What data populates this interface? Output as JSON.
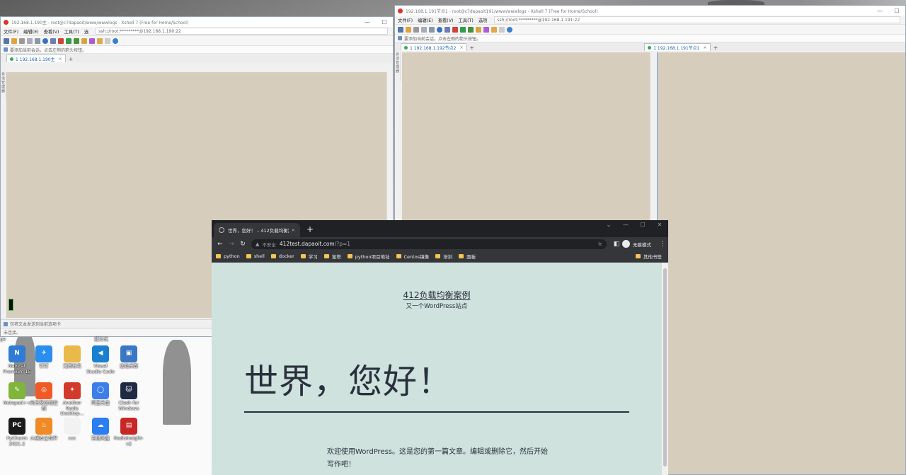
{
  "xshell_left": {
    "title": "192.168.1.190主 - root@c7dapaoit/www/wwwlogs - Xshell 7 (Free for Home/School)",
    "menu": [
      "文件(F)",
      "编辑(E)",
      "查看(V)",
      "工具(T)",
      "选"
    ],
    "address": "ssh://root:*********@192.168.1.190:22",
    "hint": "要添加当前会话，点击左侧的箭头按钮。",
    "tab_label": "1 192.168.1.190主",
    "side_label": "会话管理器",
    "status": "仅将文本发送到当前选项卡",
    "disconnected": "未连接。"
  },
  "xshell_right": {
    "title": "192.168.1.191节点1 - root@c7dapaoit191/www/wwwlogs - Xshell 7 (Free for Home/School)",
    "menu": [
      "文件(F)",
      "编辑(E)",
      "查看(V)",
      "工具(T)",
      "选项"
    ],
    "address": "ssh://root:*********@192.168.1.191:22",
    "hint": "要添加当前会话，点击左侧的箭头按钮。",
    "tab_left": "1 192.168.1.192节点2",
    "tab_right": "1 192.168.1.191节点1",
    "side_label": "会话管理器"
  },
  "desktop": {
    "partial_labels": [
      "ge",
      "捷方式"
    ],
    "icons": [
      {
        "label": "Navicat Premium 15",
        "icon": "navicat-icon",
        "color": "#2f7bd6",
        "glyph": "N"
      },
      {
        "label": "钉钉",
        "icon": "dingtalk-icon",
        "color": "#2a8ef0",
        "glyph": "✈"
      },
      {
        "label": "无图标名",
        "icon": "folder-icon",
        "color": "#e9b949",
        "glyph": ""
      },
      {
        "label": "Visual Studio Code",
        "icon": "vscode-icon",
        "color": "#1b7fd1",
        "glyph": "◀"
      },
      {
        "label": "远程桌面",
        "icon": "remote-desktop-icon",
        "color": "#3a78c4",
        "glyph": "▣"
      },
      {
        "label": "Notepad++",
        "icon": "notepadpp-icon",
        "color": "#7fb53a",
        "glyph": "✎"
      },
      {
        "label": "向日葵远程控制",
        "icon": "sunlogin-icon",
        "color": "#f15a24",
        "glyph": "◎"
      },
      {
        "label": "Another Redis Desktop...",
        "icon": "redis-desktop-icon",
        "color": "#d33a2c",
        "glyph": "✦"
      },
      {
        "label": "阿里云盘",
        "icon": "aliyun-drive-icon",
        "color": "#3d7fe8",
        "glyph": "◯"
      },
      {
        "label": "Clash for Windows",
        "icon": "clash-icon",
        "color": "#1f2a44",
        "glyph": "🐱"
      },
      {
        "label": "PyCharm 2021.2",
        "icon": "pycharm-icon",
        "color": "#1a1a1a",
        "glyph": "PC"
      },
      {
        "label": "火绒安全软件",
        "icon": "huorong-icon",
        "color": "#f08a24",
        "glyph": "♨"
      },
      {
        "label": "ccc",
        "icon": "file-icon",
        "color": "#f2f2f2",
        "glyph": ""
      },
      {
        "label": "百度网盘",
        "icon": "baidu-netdisk-icon",
        "color": "#2b7df3",
        "glyph": "☁"
      },
      {
        "label": "RedisInsight-v2",
        "icon": "redisinsight-icon",
        "color": "#c62828",
        "glyph": "▤"
      }
    ]
  },
  "chrome": {
    "tab_title": "世界，您好！ – 412负载均衡案例",
    "security": "不安全",
    "url_host": "412test.dapaoit.com",
    "url_path": "/?p=1",
    "incognito": "无痕模式",
    "bookmarks": [
      "python",
      "shell",
      "docker",
      "学习",
      "宝塔",
      "python项目地址",
      "Centos镜像",
      "培训",
      "面板"
    ],
    "other_bookmarks": "其他书签",
    "page": {
      "site_title": "412负载均衡案例",
      "site_description": "又一个WordPress站点",
      "post_title": "世界，您好！",
      "post_body": "欢迎使用WordPress。这是您的第一篇文章。编辑或删除它，然后开始写作吧！"
    }
  }
}
